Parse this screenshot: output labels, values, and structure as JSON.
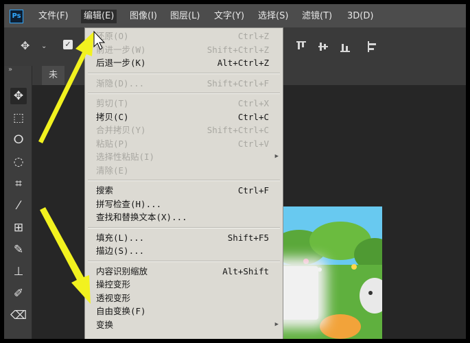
{
  "menubar": {
    "logo": "Ps",
    "items": [
      {
        "label": "文件(F)",
        "active": false
      },
      {
        "label": "编辑(E)",
        "active": true
      },
      {
        "label": "图像(I)",
        "active": false
      },
      {
        "label": "图层(L)",
        "active": false
      },
      {
        "label": "文字(Y)",
        "active": false
      },
      {
        "label": "选择(S)",
        "active": false
      },
      {
        "label": "滤镜(T)",
        "active": false
      },
      {
        "label": "3D(D)",
        "active": false
      }
    ]
  },
  "options_bar": {
    "move_tool_icon": "move-icon",
    "dropdown_icon": "chevron-down-icon",
    "checkbox_checked": true
  },
  "document": {
    "tab_label": "未"
  },
  "edit_menu": {
    "items": [
      {
        "label": "还原(O)",
        "shortcut": "Ctrl+Z",
        "enabled": false,
        "submenu": false
      },
      {
        "label": "前进一步(W)",
        "shortcut": "Shift+Ctrl+Z",
        "enabled": false,
        "submenu": false
      },
      {
        "label": "后退一步(K)",
        "shortcut": "Alt+Ctrl+Z",
        "enabled": true,
        "submenu": false
      },
      {
        "separator": true
      },
      {
        "label": "渐隐(D)...",
        "shortcut": "Shift+Ctrl+F",
        "enabled": false,
        "submenu": false
      },
      {
        "separator": true
      },
      {
        "label": "剪切(T)",
        "shortcut": "Ctrl+X",
        "enabled": false,
        "submenu": false
      },
      {
        "label": "拷贝(C)",
        "shortcut": "Ctrl+C",
        "enabled": true,
        "submenu": false
      },
      {
        "label": "合并拷贝(Y)",
        "shortcut": "Shift+Ctrl+C",
        "enabled": false,
        "submenu": false
      },
      {
        "label": "粘贴(P)",
        "shortcut": "Ctrl+V",
        "enabled": false,
        "submenu": false
      },
      {
        "label": "选择性粘贴(I)",
        "shortcut": "",
        "enabled": false,
        "submenu": true
      },
      {
        "label": "清除(E)",
        "shortcut": "",
        "enabled": false,
        "submenu": false
      },
      {
        "separator": true
      },
      {
        "label": "搜索",
        "shortcut": "Ctrl+F",
        "enabled": true,
        "submenu": false
      },
      {
        "label": "拼写检查(H)...",
        "shortcut": "",
        "enabled": true,
        "submenu": false
      },
      {
        "label": "查找和替换文本(X)...",
        "shortcut": "",
        "enabled": true,
        "submenu": false
      },
      {
        "separator": true
      },
      {
        "label": "填充(L)...",
        "shortcut": "Shift+F5",
        "enabled": true,
        "submenu": false
      },
      {
        "label": "描边(S)...",
        "shortcut": "",
        "enabled": true,
        "submenu": false
      },
      {
        "separator": true
      },
      {
        "label": "内容识别缩放",
        "shortcut": "Alt+Shift",
        "enabled": true,
        "submenu": false
      },
      {
        "label": "操控变形",
        "shortcut": "",
        "enabled": true,
        "submenu": false
      },
      {
        "label": "透视变形",
        "shortcut": "",
        "enabled": true,
        "submenu": false
      },
      {
        "label": "自由变换(F)",
        "shortcut": "",
        "enabled": true,
        "submenu": false
      },
      {
        "label": "变换",
        "shortcut": "",
        "enabled": true,
        "submenu": true
      }
    ]
  },
  "toolbox": {
    "tools": [
      "move-tool-icon",
      "marquee-tool-icon",
      "lasso-tool-icon",
      "quick-selection-tool-icon",
      "crop-tool-icon",
      "eyedropper-tool-icon",
      "healing-brush-tool-icon",
      "brush-tool-icon",
      "clone-stamp-tool-icon",
      "history-brush-tool-icon",
      "eraser-tool-icon"
    ]
  },
  "annotation": {
    "arrow_color": "#f2f21f"
  }
}
